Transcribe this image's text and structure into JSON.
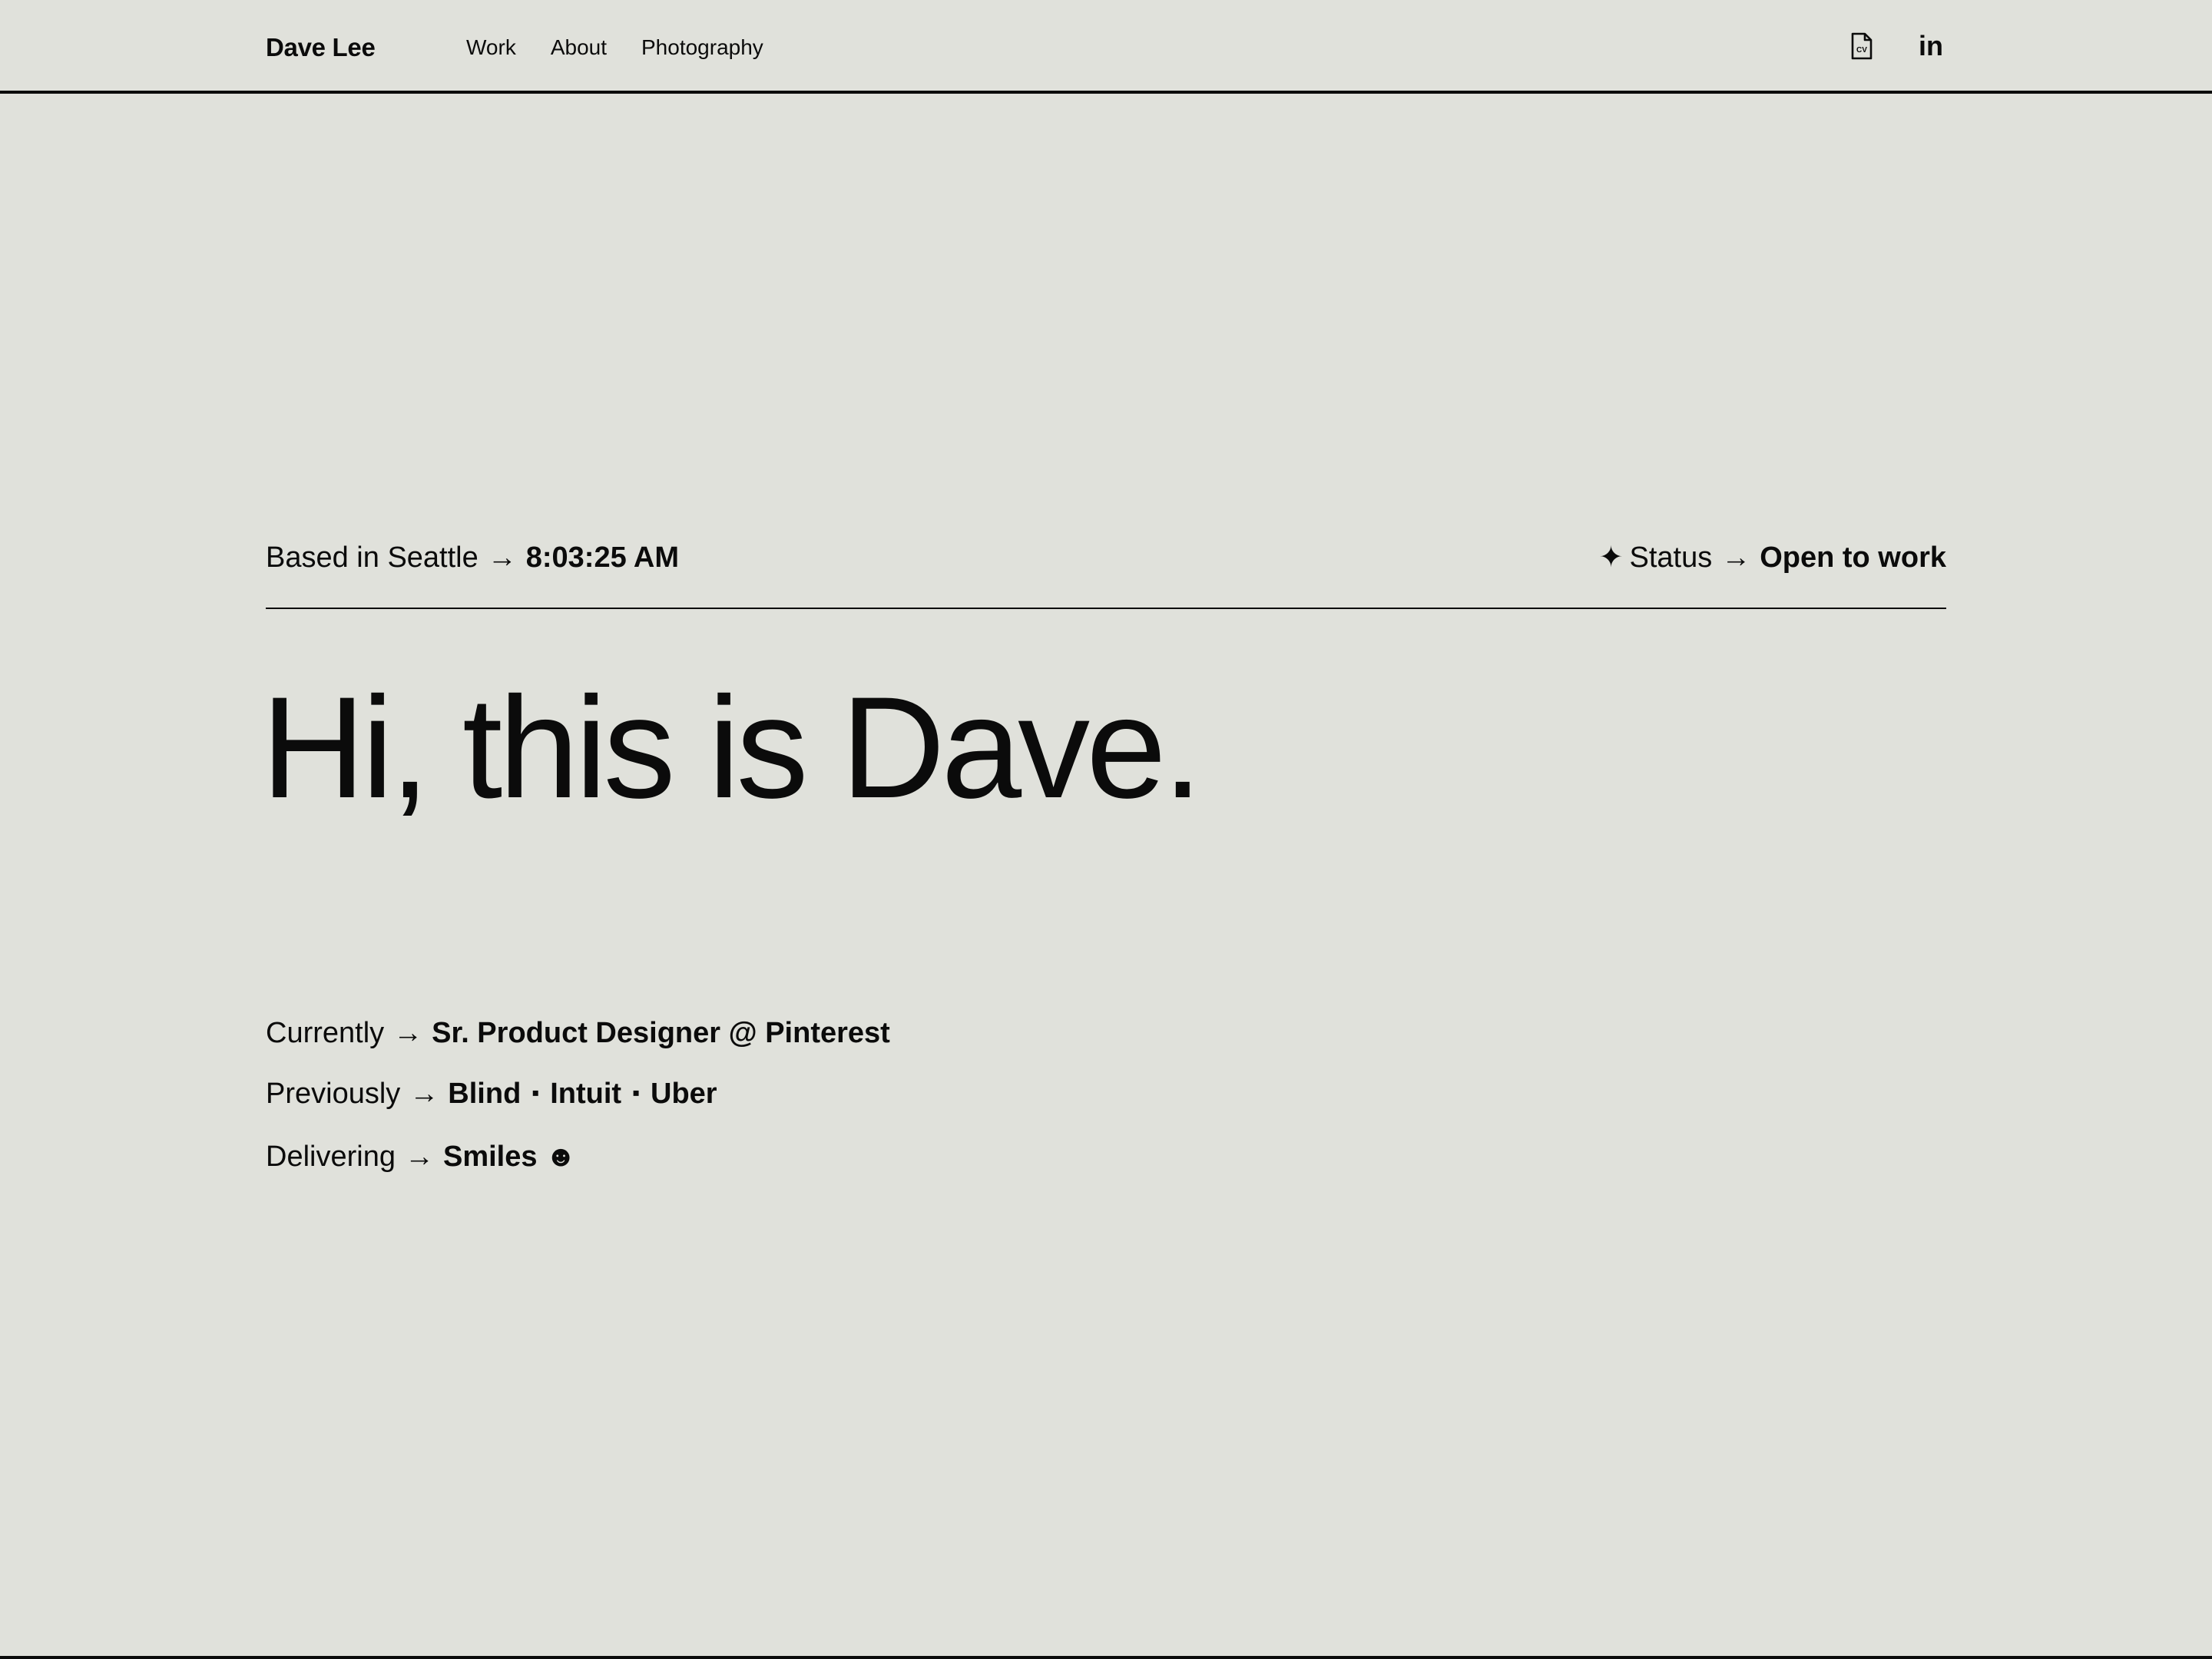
{
  "header": {
    "brand": "Dave Lee",
    "nav": [
      "Work",
      "About",
      "Photography"
    ],
    "icons": [
      "cv-document-icon",
      "linkedin-icon"
    ],
    "cv_label": "CV",
    "linkedin_label": "in"
  },
  "meta": {
    "location_label": "Based in Seattle",
    "arrow": "→",
    "time": "8:03:25 AM",
    "status_sparkle": "✦",
    "status_label": "Status",
    "status_value": "Open to work"
  },
  "hero": {
    "title": "Hi, this is Dave."
  },
  "details": {
    "currently_label": "Currently",
    "currently_value": "Sr. Product Designer @ Pinterest",
    "previously_label": "Previously",
    "previously_items": [
      "Blind",
      "Intuit",
      "Uber"
    ],
    "separator": "▪",
    "delivering_label": "Delivering",
    "delivering_value": "Smiles",
    "delivering_emoji": "☻"
  },
  "colors": {
    "background": "#e0e1db",
    "text": "#0b0b0b"
  }
}
